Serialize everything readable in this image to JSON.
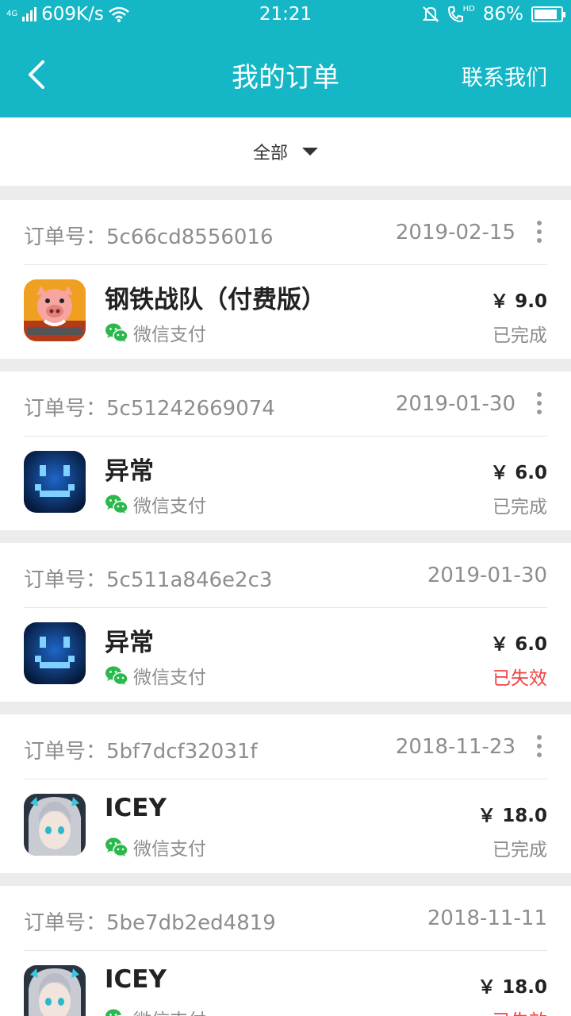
{
  "status_bar": {
    "network_type": "4G",
    "speed": "609K/s",
    "time": "21:21",
    "hd_label": "HD",
    "battery_pct": "86%",
    "battery_level": 0.86
  },
  "header": {
    "title": "我的订单",
    "contact_label": "联系我们",
    "bg_color": "#15b7c6"
  },
  "filter": {
    "selected": "全部"
  },
  "orders": [
    {
      "order_label": "订单号：",
      "order_id": "5c66cd8556016",
      "date": "2019-02-15",
      "has_more": true,
      "game": "钢铁战队（付费版）",
      "icon": "steel-team-pig",
      "payment": "微信支付",
      "price": "￥ 9.0",
      "status": "已完成",
      "status_color": "#8d8d8d"
    },
    {
      "order_label": "订单号：",
      "order_id": "5c51242669074",
      "date": "2019-01-30",
      "has_more": true,
      "game": "异常",
      "icon": "anomaly-robot",
      "payment": "微信支付",
      "price": "￥ 6.0",
      "status": "已完成",
      "status_color": "#8d8d8d"
    },
    {
      "order_label": "订单号：",
      "order_id": "5c511a846e2c3",
      "date": "2019-01-30",
      "has_more": false,
      "game": "异常",
      "icon": "anomaly-robot",
      "payment": "微信支付",
      "price": "￥ 6.0",
      "status": "已失效",
      "status_color": "#f04141"
    },
    {
      "order_label": "订单号：",
      "order_id": "5bf7dcf32031f",
      "date": "2018-11-23",
      "has_more": true,
      "game": "ICEY",
      "icon": "icey-girl",
      "payment": "微信支付",
      "price": "￥ 18.0",
      "status": "已完成",
      "status_color": "#8d8d8d"
    },
    {
      "order_label": "订单号：",
      "order_id": "5be7db2ed4819",
      "date": "2018-11-11",
      "has_more": false,
      "game": "ICEY",
      "icon": "icey-girl",
      "payment": "微信支付",
      "price": "￥ 18.0",
      "status": "已失效",
      "status_color": "#f04141"
    }
  ]
}
